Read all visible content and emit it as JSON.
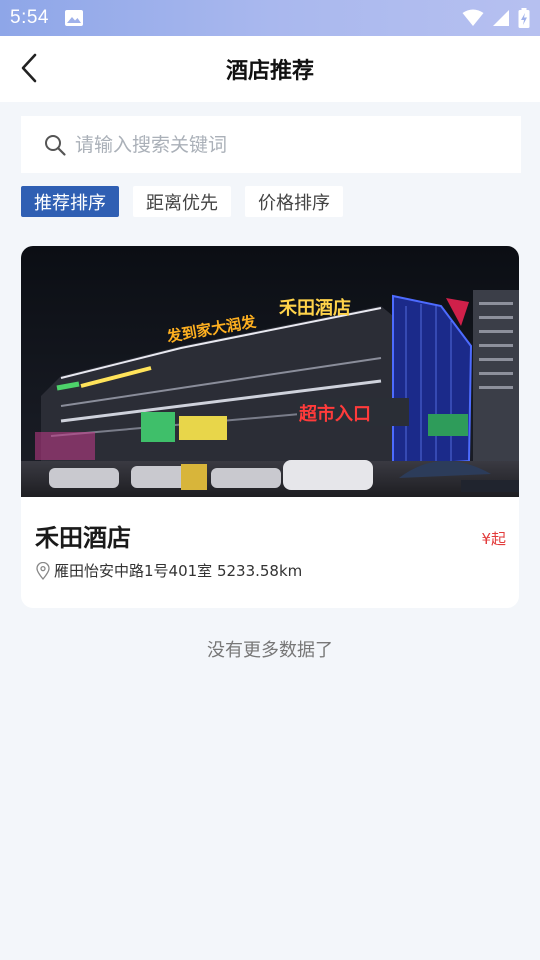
{
  "status_bar": {
    "time": "5:54",
    "icons": [
      "image-icon",
      "wifi-icon",
      "signal-icon",
      "battery-charging-icon"
    ]
  },
  "nav": {
    "title": "酒店推荐",
    "back_icon": "chevron-left-icon"
  },
  "search": {
    "placeholder": "请输入搜索关键词",
    "value": "",
    "icon": "search-icon"
  },
  "sort_tabs": [
    {
      "label": "推荐排序",
      "active": true
    },
    {
      "label": "距离优先",
      "active": false
    },
    {
      "label": "价格排序",
      "active": false
    }
  ],
  "hotels": [
    {
      "name": "禾田酒店",
      "price_text": "¥起",
      "address": "雁田怡安中路1号401室 5233.58km",
      "photo_signs": {
        "main": "禾田酒店",
        "second": "发到家大润发",
        "entrance": "超市入口"
      }
    }
  ],
  "footer": {
    "no_more": "没有更多数据了"
  },
  "colors": {
    "status_bar": "#a3b4ec",
    "active_tab": "#2f5fb3",
    "price": "#e23b3b",
    "page_bg": "#f3f6fa"
  }
}
